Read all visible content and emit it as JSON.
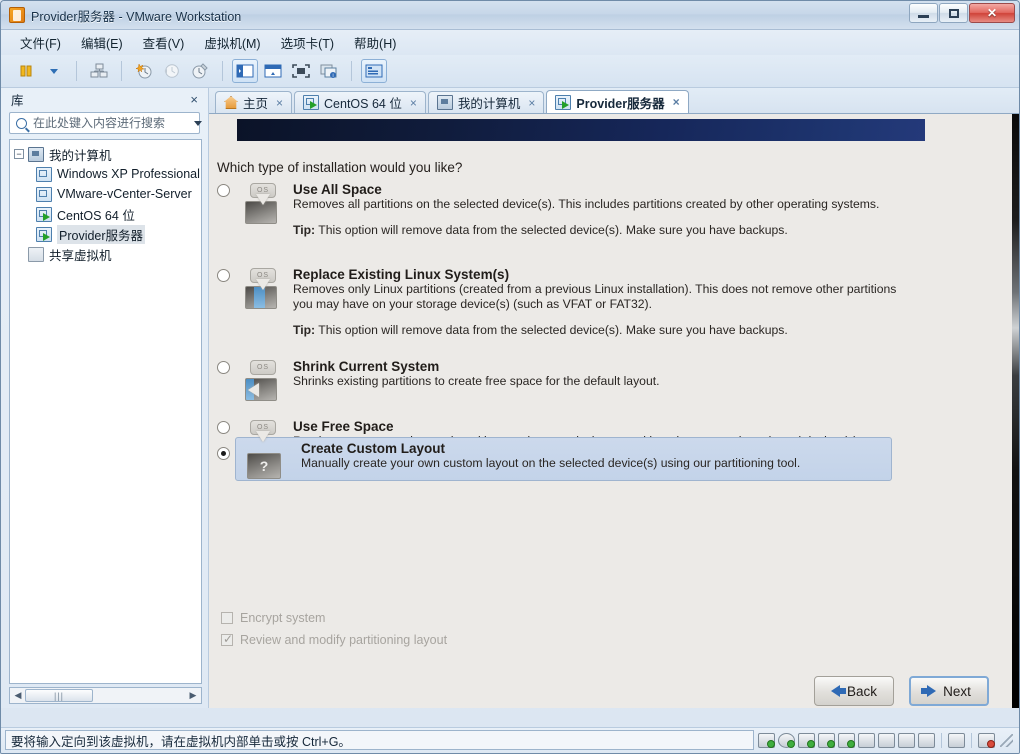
{
  "window": {
    "title": "Provider服务器 - VMware Workstation",
    "app_icon": "vmware-icon",
    "minimize_label": "最小化",
    "maximize_label": "最大化",
    "close_label": "关闭"
  },
  "menubar": {
    "items": [
      {
        "label": "文件(F)",
        "name": "menu-file"
      },
      {
        "label": "编辑(E)",
        "name": "menu-edit"
      },
      {
        "label": "查看(V)",
        "name": "menu-view"
      },
      {
        "label": "虚拟机(M)",
        "name": "menu-vm"
      },
      {
        "label": "选项卡(T)",
        "name": "menu-tabs"
      },
      {
        "label": "帮助(H)",
        "name": "menu-help"
      }
    ]
  },
  "toolbar": {
    "buttons": [
      {
        "name": "power-button-icon"
      },
      {
        "name": "dropdown-caret-icon"
      },
      {
        "name": "manage-snapshots-icon"
      },
      {
        "name": "take-snapshot-icon"
      },
      {
        "name": "revert-snapshot-icon"
      },
      {
        "name": "snapshot-manager-icon"
      },
      {
        "name": "show-library-icon"
      },
      {
        "name": "show-thumbnail-bar-icon"
      },
      {
        "name": "full-screen-icon"
      },
      {
        "name": "unity-mode-icon"
      },
      {
        "name": "console-view-icon"
      }
    ]
  },
  "sidebar": {
    "header_title": "库",
    "close_label": "×",
    "search": {
      "placeholder": "在此处键入内容进行搜索",
      "value": ""
    },
    "tree": [
      {
        "label": "我的计算机",
        "icon": "my-computer-icon",
        "level": 0,
        "expander": "-",
        "selected": false
      },
      {
        "label": "Windows XP Professional",
        "icon": "vm-icon",
        "level": 1,
        "selected": false
      },
      {
        "label": "VMware-vCenter-Server",
        "icon": "vm-icon",
        "level": 1,
        "selected": false
      },
      {
        "label": "CentOS 64 位",
        "icon": "vm-running-icon",
        "level": 1,
        "selected": false
      },
      {
        "label": "Provider服务器",
        "icon": "vm-running-icon",
        "level": 1,
        "selected": true
      },
      {
        "label": "共享虚拟机",
        "icon": "shared-vms-icon",
        "level": 0,
        "selected": false
      }
    ],
    "scroll_thumb": "|||"
  },
  "tabs": [
    {
      "label": "主页",
      "icon": "home-icon",
      "active": false,
      "close": "×"
    },
    {
      "label": "CentOS 64 位",
      "icon": "vm-running-icon",
      "active": false,
      "close": "×"
    },
    {
      "label": "我的计算机",
      "icon": "my-computer-icon",
      "active": false,
      "close": "×"
    },
    {
      "label": "Provider服务器",
      "icon": "vm-running-icon",
      "active": true,
      "close": "×"
    }
  ],
  "installer": {
    "question": "Which type of installation would you like?",
    "options": [
      {
        "title": "Use All Space",
        "desc": "Removes all partitions on the selected device(s).  This includes partitions created by other operating systems.",
        "tip_label": "Tip:",
        "tip": " This option will remove data from the selected device(s).  Make sure you have backups.",
        "icon": "disk-erase-all-icon",
        "selected": false
      },
      {
        "title": "Replace Existing Linux System(s)",
        "desc": "Removes only Linux partitions (created from a previous Linux installation).  This does not remove other partitions you may have on your storage device(s) (such as VFAT or FAT32).",
        "tip_label": "Tip:",
        "tip": " This option will remove data from the selected device(s).  Make sure you have backups.",
        "icon": "disk-replace-linux-icon",
        "selected": false
      },
      {
        "title": "Shrink Current System",
        "desc": "Shrinks existing partitions to create free space for the default layout.",
        "tip_label": "",
        "tip": "",
        "icon": "disk-shrink-icon",
        "selected": false
      },
      {
        "title": "Use Free Space",
        "desc": "Retains your current data and partitions and uses only the unpartitioned space on the selected device (s), assuming you have enough free space available.",
        "tip_label": "",
        "tip": "",
        "icon": "disk-free-space-icon",
        "selected": false
      },
      {
        "title": "Create Custom Layout",
        "desc": "Manually create your own custom layout on the selected device(s) using our partitioning tool.",
        "tip_label": "",
        "tip": "",
        "icon": "disk-custom-layout-icon",
        "selected": true
      }
    ],
    "checkboxes": [
      {
        "label": "Encrypt system",
        "checked": false,
        "name": "encrypt-system-checkbox"
      },
      {
        "label": "Review and modify partitioning layout",
        "checked": true,
        "name": "review-layout-checkbox"
      }
    ],
    "back_button": "Back",
    "next_button": "Next"
  },
  "statusbar": {
    "message": "要将输入定向到该虚拟机，请在虚拟机内部单击或按 Ctrl+G。",
    "devices": [
      {
        "name": "hard-disk-icon"
      },
      {
        "name": "cd-dvd-icon"
      },
      {
        "name": "network-adapter-icon"
      },
      {
        "name": "printer-icon"
      },
      {
        "name": "usb-icon"
      },
      {
        "name": "sound-card-icon"
      },
      {
        "name": "camera-icon"
      },
      {
        "name": "floppy-icon"
      },
      {
        "name": "display-icon"
      },
      {
        "name": "message-log-icon"
      },
      {
        "name": "vm-disconnect-icon"
      }
    ]
  },
  "colors": {
    "accent": "#2f6ab5",
    "banner": "#16275a",
    "highlight": "#ccd9ec",
    "installer_bg": "#eceae7"
  }
}
